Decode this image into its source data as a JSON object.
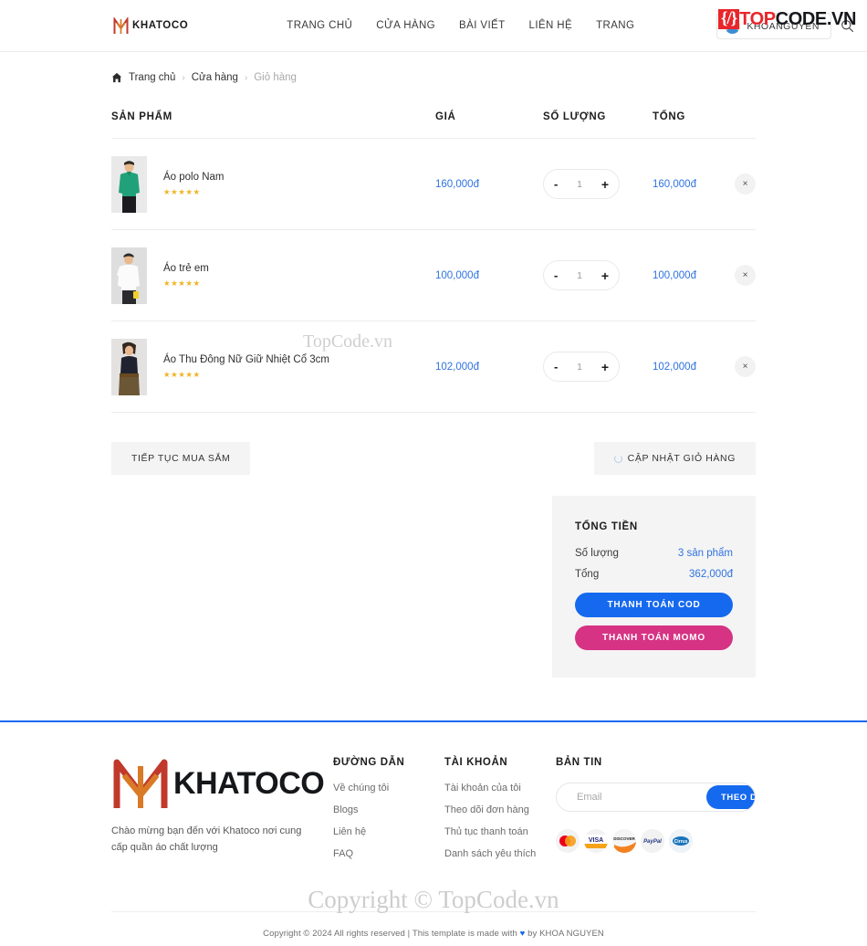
{
  "header": {
    "brand": "KHATOCO",
    "nav": [
      {
        "label": "TRANG CHỦ"
      },
      {
        "label": "CỬA HÀNG"
      },
      {
        "label": "BÀI VIẾT"
      },
      {
        "label": "LIÊN HỆ"
      },
      {
        "label": "TRANG"
      }
    ],
    "account": "KHOANGUYEN",
    "search_icon": "search-icon"
  },
  "watermark": {
    "badge": "{/}",
    "top": "TOP",
    "code": "CODE",
    "vn": ".VN",
    "middle": "TopCode.vn",
    "bottom": "Copyright © TopCode.vn"
  },
  "breadcrumb": {
    "home_icon": "home-icon",
    "items": [
      {
        "label": "Trang chủ"
      },
      {
        "label": "Cửa hàng"
      },
      {
        "label": "Giỏ hàng"
      }
    ],
    "separator": "›"
  },
  "cart": {
    "columns": {
      "product": "SẢN PHẨM",
      "price": "GIÁ",
      "quantity": "SỐ LƯỢNG",
      "total": "TỔNG"
    },
    "items": [
      {
        "name": "Áo polo Nam",
        "rating": "★★★★★",
        "price": "160,000đ",
        "quantity": "1",
        "total": "160,000đ",
        "minus": "-",
        "plus": "+",
        "remove": "×"
      },
      {
        "name": "Áo trẻ em",
        "rating": "★★★★★",
        "price": "100,000đ",
        "quantity": "1",
        "total": "100,000đ",
        "minus": "-",
        "plus": "+",
        "remove": "×"
      },
      {
        "name": "Áo Thu Đông Nữ Giữ Nhiệt Cổ 3cm",
        "rating": "★★★★★",
        "price": "102,000đ",
        "quantity": "1",
        "total": "102,000đ",
        "minus": "-",
        "plus": "+",
        "remove": "×"
      }
    ],
    "continue_shopping": "TIẾP TỤC MUA SẮM",
    "update_cart": "CẬP NHẬT GIỎ HÀNG"
  },
  "totals": {
    "title": "TỔNG TIỀN",
    "quantity_label": "Số lượng",
    "quantity_value": "3 sản phẩm",
    "total_label": "Tổng",
    "total_value": "362,000đ",
    "pay_cod": "THANH TOÁN COD",
    "pay_momo": "THANH TOÁN MOMO"
  },
  "footer": {
    "brand": "KHATOCO",
    "tagline": "Chào mừng bạn đến với Khatoco nơi cung cấp quần áo chất lượng",
    "links_title": "ĐƯỜNG DẪN",
    "links": [
      {
        "label": "Về chúng tôi"
      },
      {
        "label": "Blogs"
      },
      {
        "label": "Liên hệ"
      },
      {
        "label": "FAQ"
      }
    ],
    "account_title": "TÀI KHOẢN",
    "account_links": [
      {
        "label": "Tài khoản của tôi"
      },
      {
        "label": "Theo dõi đơn hàng"
      },
      {
        "label": "Thủ tục thanh toán"
      },
      {
        "label": "Danh sách yêu thích"
      }
    ],
    "newsletter_title": "BẢN TIN",
    "newsletter_placeholder": "Email",
    "newsletter_value": "",
    "subscribe": "THEO DÕI",
    "payment_icons": [
      {
        "name": "mastercard-icon",
        "label": "MasterCard"
      },
      {
        "name": "visa-icon",
        "label": "VISA"
      },
      {
        "name": "discover-icon",
        "label": "DISCOVER"
      },
      {
        "name": "paypal-icon",
        "label": "PayPal"
      },
      {
        "name": "cirrus-icon",
        "label": "Cirrus"
      }
    ],
    "copyright_prefix": "Copyright © 2024 All rights reserved | This template is made with ",
    "copyright_heart": "♥",
    "copyright_suffix": " by KHOA NGUYEN"
  },
  "colors": {
    "accent_blue": "#1569ee",
    "link_blue": "#2f72e0",
    "momo_pink": "#d63384",
    "star_gold": "#f0b323",
    "brand_red": "#c0392b",
    "brand_orange": "#d97a26"
  }
}
